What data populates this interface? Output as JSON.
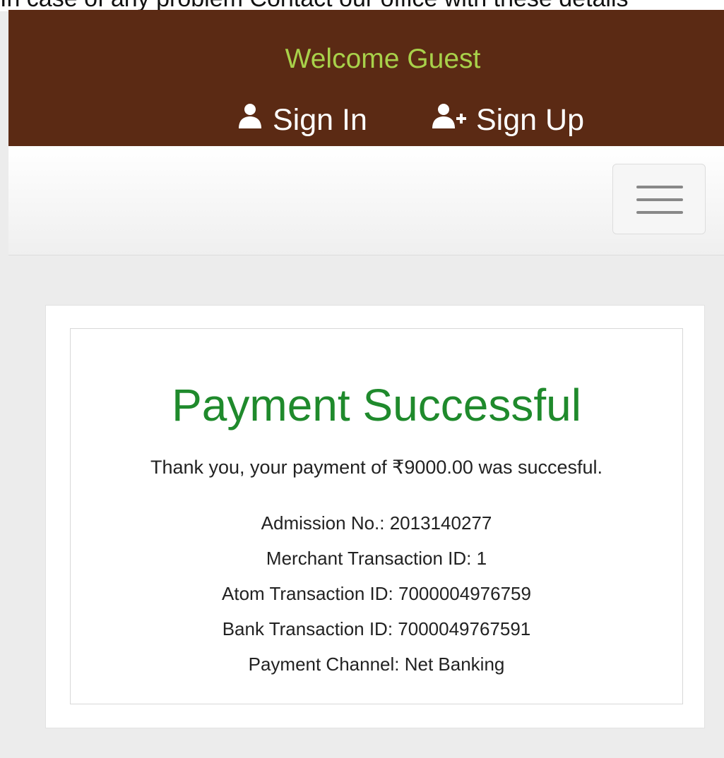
{
  "notice": {
    "text": "In case of any problem Contact our office with these details"
  },
  "header": {
    "welcome": "Welcome Guest",
    "sign_in_label": "Sign In",
    "sign_up_label": "Sign Up",
    "colors": {
      "background": "#5b2a14",
      "welcome_text": "#a8d14a",
      "link_text": "#ffffff"
    },
    "icons": {
      "sign_in": "user-icon",
      "sign_up": "user-add-icon"
    }
  },
  "navbar": {
    "menu_icon": "hamburger-menu-icon"
  },
  "payment": {
    "title": "Payment Successful",
    "message": "Thank you, your payment of ₹9000.00 was succesful.",
    "details": [
      "Admission No.: 2013140277",
      "Merchant Transaction ID: 1",
      "Atom Transaction ID: 7000004976759",
      "Bank Transaction ID: 7000049767591",
      "Payment Channel: Net Banking"
    ],
    "colors": {
      "title": "#1f8a2c",
      "text": "#222222"
    }
  }
}
